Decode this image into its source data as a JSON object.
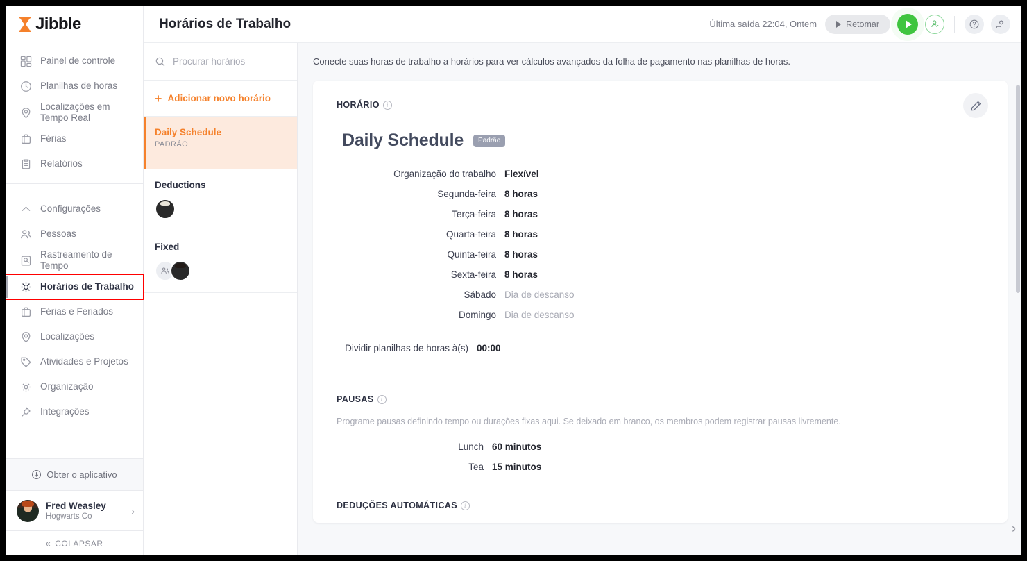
{
  "brand": {
    "name": "Jibble",
    "accent": "#f5812b"
  },
  "sidebar": {
    "items_top": [
      {
        "label": "Painel de controle",
        "icon": "dashboard-icon"
      },
      {
        "label": "Planilhas de horas",
        "icon": "clock-icon"
      },
      {
        "label": "Localizações em Tempo Real",
        "icon": "pin-icon"
      },
      {
        "label": "Férias",
        "icon": "briefcase-icon"
      },
      {
        "label": "Relatórios",
        "icon": "clipboard-icon"
      }
    ],
    "items_bottom": [
      {
        "label": "Configurações",
        "icon": "chevron-up-icon"
      },
      {
        "label": "Pessoas",
        "icon": "people-icon"
      },
      {
        "label": "Rastreamento de Tempo",
        "icon": "time-tracking-icon"
      },
      {
        "label": "Horários de Trabalho",
        "icon": "schedule-icon"
      },
      {
        "label": "Férias e Feriados",
        "icon": "briefcase-icon"
      },
      {
        "label": "Localizações",
        "icon": "pin-icon"
      },
      {
        "label": "Atividades e Projetos",
        "icon": "tag-icon"
      },
      {
        "label": "Organização",
        "icon": "gear-icon"
      },
      {
        "label": "Integrações",
        "icon": "plug-icon"
      }
    ],
    "get_app": "Obter o aplicativo",
    "user": {
      "name": "Fred Weasley",
      "org": "Hogwarts Co"
    },
    "collapse": "COLAPSAR"
  },
  "topbar": {
    "title": "Horários de Trabalho",
    "last_out": "Última saída 22:04, Ontem",
    "resume_label": "Retomar",
    "icons": [
      "play-icon",
      "person-check-icon",
      "help-icon",
      "hand-gear-icon"
    ]
  },
  "list_panel": {
    "search_placeholder": "Procurar horários",
    "search_value": "",
    "add_label": "Adicionar novo horário",
    "schedules": [
      {
        "name": "Daily Schedule",
        "sub": "PADRÃO",
        "selected": true,
        "avatars": []
      },
      {
        "name": "Deductions",
        "sub": "",
        "selected": false,
        "avatars": [
          "draco"
        ]
      },
      {
        "name": "Fixed",
        "sub": "",
        "selected": false,
        "avatars": [
          "group",
          "cho"
        ]
      }
    ]
  },
  "content": {
    "intro": "Conecte suas horas de trabalho a horários para ver cálculos avançados da folha de pagamento nas planilhas de horas.",
    "section_schedule": "HORÁRIO",
    "schedule_title": "Daily Schedule",
    "schedule_badge": "Padrão",
    "rows": [
      {
        "key": "Organização do trabalho",
        "value": "Flexível",
        "muted": false
      },
      {
        "key": "Segunda-feira",
        "value": "8 horas",
        "muted": false
      },
      {
        "key": "Terça-feira",
        "value": "8 horas",
        "muted": false
      },
      {
        "key": "Quarta-feira",
        "value": "8 horas",
        "muted": false
      },
      {
        "key": "Quinta-feira",
        "value": "8 horas",
        "muted": false
      },
      {
        "key": "Sexta-feira",
        "value": "8 horas",
        "muted": false
      },
      {
        "key": "Sábado",
        "value": "Dia de descanso",
        "muted": true
      },
      {
        "key": "Domingo",
        "value": "Dia de descanso",
        "muted": true
      }
    ],
    "split_key": "Dividir planilhas de horas à(s)",
    "split_value": "00:00",
    "section_breaks": "PAUSAS",
    "breaks_desc": "Programe pausas definindo tempo ou durações fixas aqui. Se deixado em branco, os membros podem registrar pausas livremente.",
    "breaks": [
      {
        "key": "Lunch",
        "value": "60 minutos"
      },
      {
        "key": "Tea",
        "value": "15 minutos"
      }
    ],
    "section_deductions": "DEDUÇÕES AUTOMÁTICAS"
  }
}
